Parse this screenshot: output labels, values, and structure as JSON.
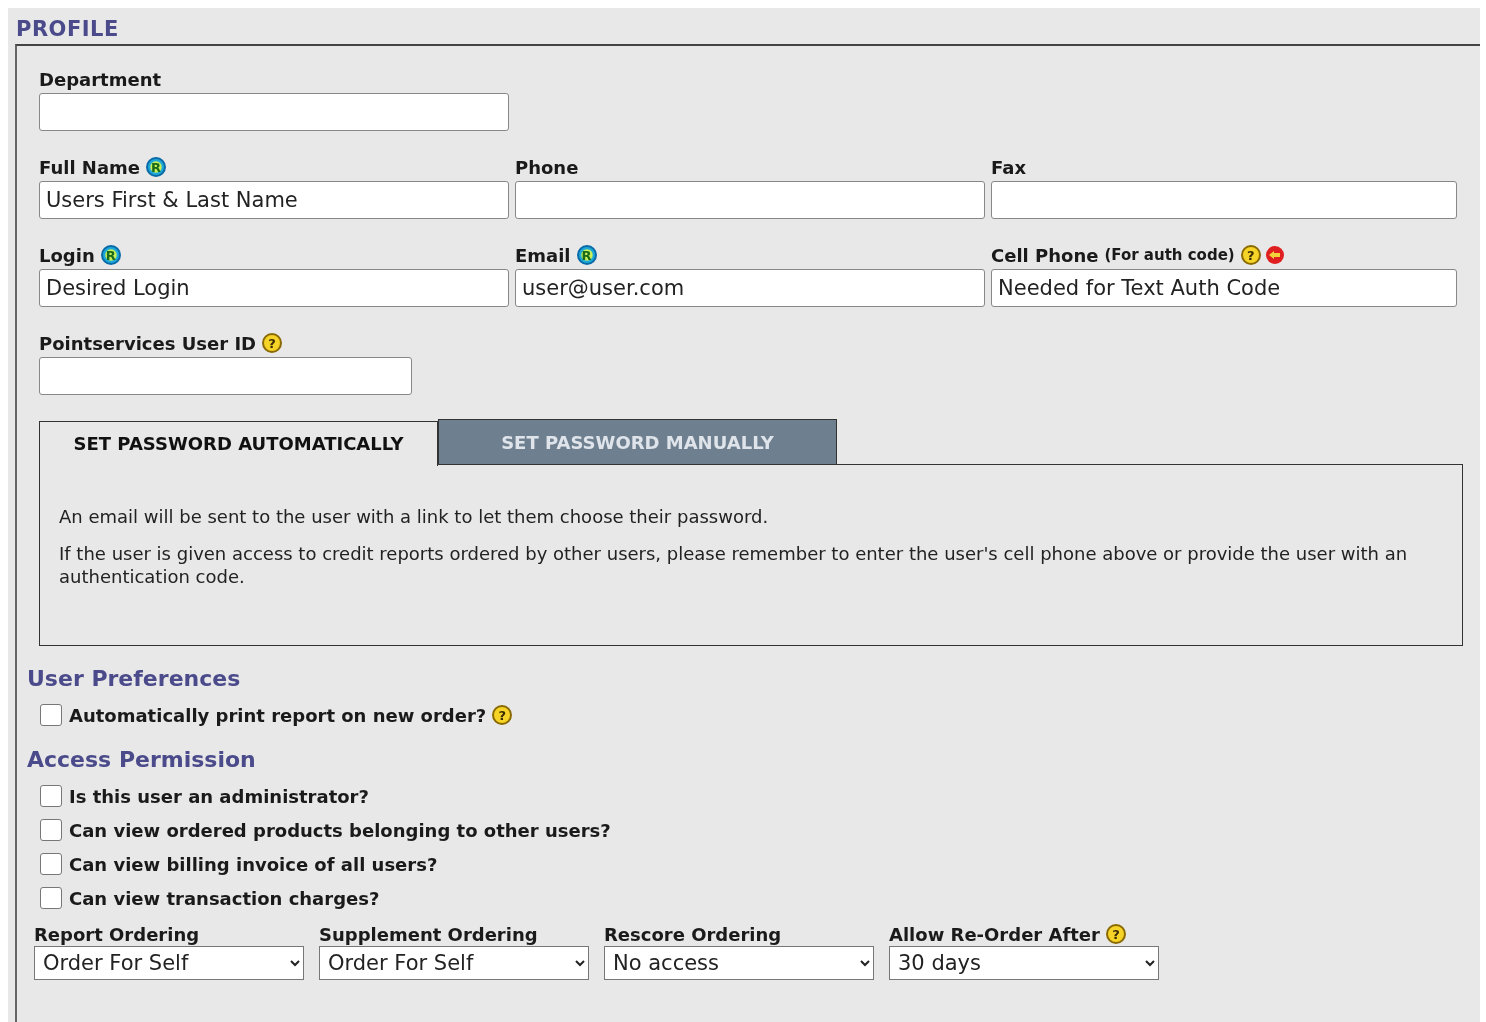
{
  "section_title": "PROFILE",
  "field_rows": [
    [
      {
        "label": "Department"
      }
    ],
    [
      {
        "label": "Full Name",
        "value": "Users First & Last Name",
        "icons": [
          {
            "kind": "required",
            "text": "R"
          }
        ]
      },
      {
        "label": "Phone"
      },
      {
        "label": "Fax"
      }
    ],
    [
      {
        "label": "Login",
        "value": "Desired Login",
        "icons": [
          {
            "kind": "required",
            "text": "R"
          }
        ]
      },
      {
        "label": "Email",
        "value": "user@user.com",
        "icons": [
          {
            "kind": "required",
            "text": "R"
          }
        ]
      },
      {
        "label": "Cell Phone",
        "note": "(For auth code)",
        "value": "Needed for Text Auth Code",
        "icons": [
          {
            "kind": "help",
            "text": "?"
          },
          {
            "kind": "alert"
          }
        ]
      }
    ],
    [
      {
        "label": "Pointservices User ID",
        "icons": [
          {
            "kind": "help",
            "text": "?"
          }
        ]
      }
    ]
  ],
  "password_tabs": [
    {
      "label": "SET PASSWORD AUTOMATICALLY",
      "selected": true
    },
    {
      "label": "SET PASSWORD MANUALLY",
      "selected": false
    }
  ],
  "password_panel": [
    "An email will be sent to the user with a link to let them choose their password.",
    "If the user is given access to credit reports ordered by other users, please remember to enter the user's cell phone above or provide the user with an authentication code."
  ],
  "sections": [
    {
      "title": "User Preferences",
      "options": [
        {
          "label": "Automatically print report on new order?",
          "checked": false,
          "icons": [
            {
              "kind": "help",
              "text": "?"
            }
          ]
        }
      ]
    },
    {
      "title": "Access Permission",
      "options": [
        {
          "label": "Is this user an administrator?",
          "checked": false
        },
        {
          "label": "Can view ordered products belonging to other users?",
          "checked": false
        },
        {
          "label": "Can view billing invoice of all users?",
          "checked": false
        },
        {
          "label": "Can view transaction charges?",
          "checked": false
        }
      ]
    }
  ],
  "selects": [
    {
      "label": "Report Ordering",
      "value": "Order For Self"
    },
    {
      "label": "Supplement Ordering",
      "value": "Order For Self"
    },
    {
      "label": "Rescore Ordering",
      "value": "No access"
    },
    {
      "label": "Allow Re-Order After",
      "value": "30 days",
      "icons": [
        {
          "kind": "help",
          "text": "?"
        }
      ]
    }
  ]
}
